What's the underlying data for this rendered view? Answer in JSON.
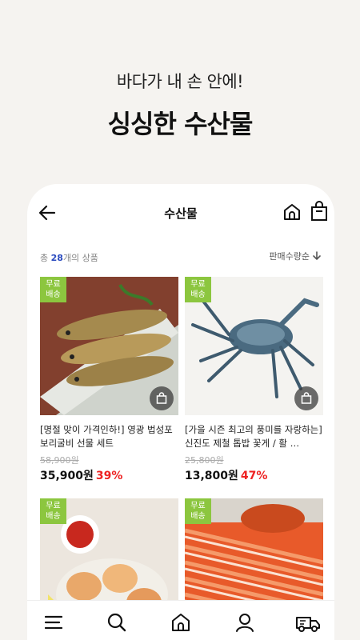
{
  "promo": {
    "subtitle": "바다가 내 손 안에!",
    "title": "싱싱한 수산물"
  },
  "appbar": {
    "title": "수산물",
    "back_icon": "arrow-left-icon",
    "home_icon": "home-icon",
    "cart_icon": "shopping-bag-icon"
  },
  "list": {
    "count_prefix": "총 ",
    "count": "28",
    "count_suffix": "개의 상품",
    "sort_label": "판매수량순"
  },
  "products": [
    {
      "badge_line1": "무료",
      "badge_line2": "배송",
      "name": "[명절 맞이 가격인하!] 영광 법성포 보리굴비 선물 세트",
      "original_price": "58,900원",
      "price": "35,900원",
      "discount": "39%"
    },
    {
      "badge_line1": "무료",
      "badge_line2": "배송",
      "name": "[가을 시즌 최고의 풍미를 자랑하는] 신진도 제철 톱밥 꽃게 / 활 …",
      "original_price": "25,800원",
      "price": "13,800원",
      "discount": "47%"
    },
    {
      "badge_line1": "무료",
      "badge_line2": "배송"
    },
    {
      "badge_line1": "무료",
      "badge_line2": "배송"
    }
  ],
  "tabbar": {
    "items": [
      "menu-icon",
      "search-icon",
      "home-icon",
      "user-icon",
      "delivery-truck-icon"
    ]
  },
  "colors": {
    "badge": "#8cc63f",
    "discount": "#e22222",
    "count": "#2b4bbf",
    "background": "#f5f3f0"
  }
}
